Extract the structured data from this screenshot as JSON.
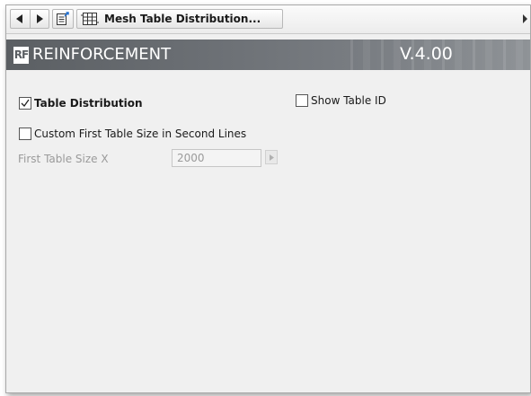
{
  "toolbar": {
    "back_icon": "triangle-left-icon",
    "forward_icon": "triangle-right-icon",
    "doc_icon": "document-arrow-icon",
    "mesh_icon": "mesh-table-icon",
    "title": "Mesh Table Distribution...",
    "overflow_icon": "chevron-right-icon"
  },
  "banner": {
    "logo_text": "RF",
    "title": "REINFORCEMENT",
    "version": "V.4.00"
  },
  "options": {
    "table_distribution": {
      "label": "Table Distribution",
      "checked": true
    },
    "show_table_id": {
      "label": "Show Table ID",
      "checked": false
    },
    "custom_first_size": {
      "label": "Custom First Table Size in Second Lines",
      "checked": false
    }
  },
  "first_table_size_x": {
    "label": "First Table Size X",
    "value": "2000",
    "disabled": true
  },
  "colors": {
    "banner_dark": "#5b5f63",
    "banner_light": "#8f9397",
    "panel_bg": "#f0f0f0",
    "disabled_text": "#9a9a9a"
  }
}
